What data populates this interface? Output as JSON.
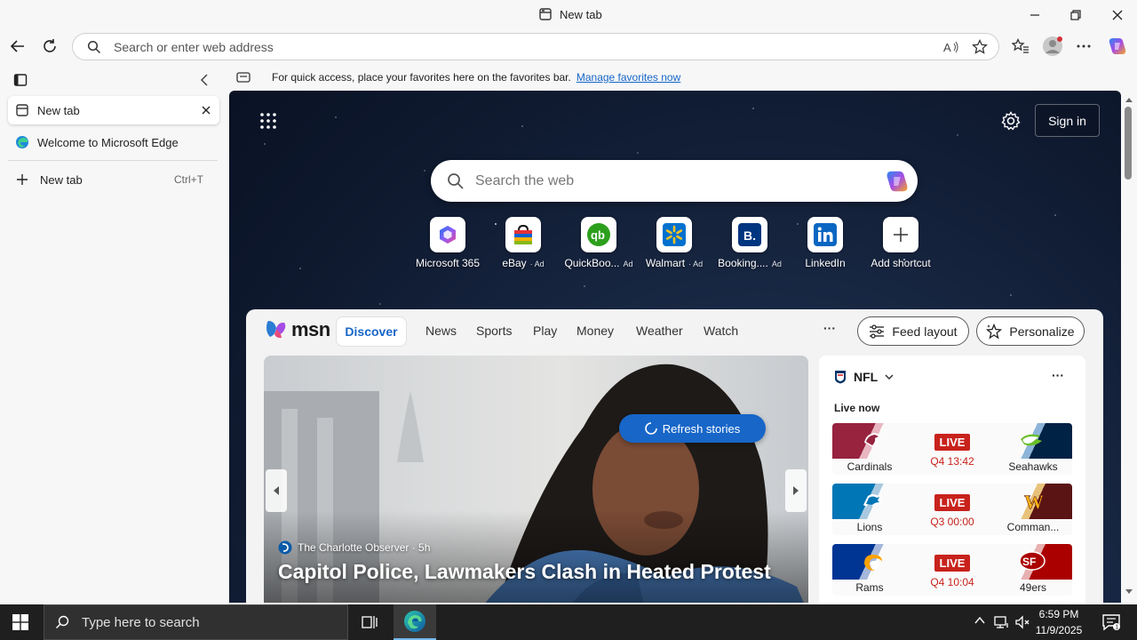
{
  "window": {
    "title": "New tab"
  },
  "toolbar": {
    "address_placeholder": "Search or enter web address"
  },
  "sidebar": {
    "tabs": [
      {
        "label": "New tab",
        "active": true
      },
      {
        "label": "Welcome to Microsoft Edge",
        "active": false
      }
    ],
    "new_tab_label": "New tab",
    "new_tab_shortcut": "Ctrl+T"
  },
  "favorites_bar": {
    "message": "For quick access, place your favorites here on the favorites bar.",
    "link": "Manage favorites now"
  },
  "ntp": {
    "search_placeholder": "Search the web",
    "sign_in": "Sign in",
    "shortcuts": [
      {
        "label": "Microsoft 365",
        "ad": ""
      },
      {
        "label": "eBay",
        "ad": "· Ad"
      },
      {
        "label": "QuickBoo...",
        "ad": "Ad"
      },
      {
        "label": "Walmart",
        "ad": "· Ad"
      },
      {
        "label": "Booking....",
        "ad": "Ad"
      },
      {
        "label": "LinkedIn",
        "ad": ""
      },
      {
        "label": "Add shortcut",
        "ad": ""
      }
    ]
  },
  "feed": {
    "brand": "msn",
    "tabs": [
      "Discover",
      "News",
      "Sports",
      "Play",
      "Money",
      "Weather",
      "Watch"
    ],
    "more": "···",
    "feed_layout": "Feed layout",
    "personalize": "Personalize",
    "refresh": "Refresh stories",
    "hero": {
      "source": "The Charlotte Observer · 5h",
      "headline": "Capitol Police, Lawmakers Clash in Heated Protest"
    },
    "nfl": {
      "title": "NFL",
      "more": "···",
      "live_now": "Live now",
      "games": [
        {
          "home": "Cardinals",
          "away": "Seahawks",
          "status": "LIVE",
          "clock": "Q4 13:42",
          "home_color": "#97233f",
          "away_color": "#002244"
        },
        {
          "home": "Lions",
          "away": "Comman...",
          "status": "LIVE",
          "clock": "Q3 00:00",
          "home_color": "#0076b6",
          "away_color": "#5a1414"
        },
        {
          "home": "Rams",
          "away": "49ers",
          "status": "LIVE",
          "clock": "Q4 10:04",
          "home_color": "#003594",
          "away_color": "#aa0000"
        }
      ]
    }
  },
  "taskbar": {
    "search_placeholder": "Type here to search",
    "time": "6:59 PM",
    "date": "11/9/2025"
  }
}
